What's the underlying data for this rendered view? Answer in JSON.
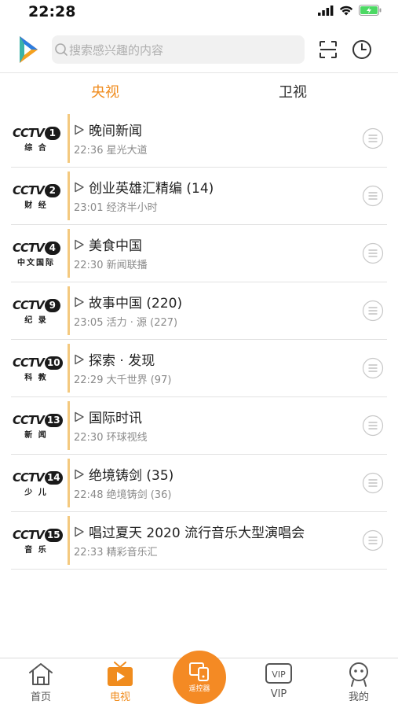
{
  "status_bar": {
    "time": "22:28"
  },
  "search": {
    "placeholder": "搜索感兴趣的内容"
  },
  "tabs": [
    {
      "label": "央视",
      "active": true
    },
    {
      "label": "卫视",
      "active": false
    }
  ],
  "channels": [
    {
      "logo_num": "1",
      "logo_sub": "综 合",
      "title": "晚间新闻",
      "next": "22:36 星光大道"
    },
    {
      "logo_num": "2",
      "logo_sub": "财 经",
      "title": "创业英雄汇精编 (14)",
      "next": "23:01 经济半小时"
    },
    {
      "logo_num": "4",
      "logo_sub": "中文国际",
      "title": "美食中国",
      "next": "22:30 新闻联播"
    },
    {
      "logo_num": "9",
      "logo_sub": "纪 录",
      "title": "故事中国 (220)",
      "next": "23:05 活力 · 源 (227)"
    },
    {
      "logo_num": "10",
      "logo_sub": "科 教",
      "title": "探索 · 发现",
      "next": "22:29 大千世界 (97)"
    },
    {
      "logo_num": "13",
      "logo_sub": "新 闻",
      "title": "国际时讯",
      "next": "22:30 环球视线"
    },
    {
      "logo_num": "14",
      "logo_sub": "少 儿",
      "title": "绝境铸剑 (35)",
      "next": "22:48 绝境铸剑 (36)"
    },
    {
      "logo_num": "15",
      "logo_sub": "音 乐",
      "title": "唱过夏天 2020 流行音乐大型演唱会",
      "next": "22:33 精彩音乐汇"
    }
  ],
  "logo_word": "CCTV",
  "bottom_nav": {
    "home": "首页",
    "tv": "电视",
    "remote": "遥控器",
    "vip": "VIP",
    "vip_badge": "VIP",
    "mine": "我的"
  },
  "colors": {
    "accent": "#f08c1e",
    "divider": "#f4c97f"
  },
  "icons": [
    "logo-icon",
    "search-icon",
    "scan-icon",
    "history-icon",
    "play-icon",
    "menu-icon",
    "home-icon",
    "tv-icon",
    "remote-icon",
    "vip-icon",
    "mine-icon"
  ]
}
